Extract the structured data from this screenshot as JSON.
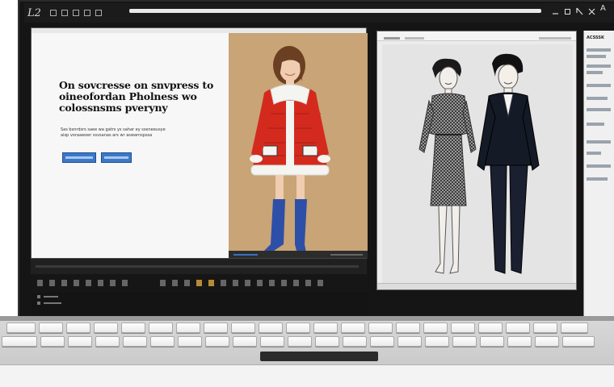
{
  "window": {
    "title": "L2"
  },
  "left_app": {
    "headline": "On sovcresse on snvpress to oineofordan Pholness wo colossnsms pveryny",
    "body_lines": [
      "Sas bsnrdsrs saee wa gatrs ys sahar ey sseneeusye",
      "aisp voraawoer ssvsanas ars wr  aswarnspssa"
    ],
    "buttons": [
      "",
      ""
    ],
    "accent_color": "#3c78c8"
  },
  "right_app": {
    "title": "",
    "side_panel_header": "ACSSSK"
  },
  "colors": {
    "bezel": "#151515",
    "keyboard": "#d0d0d0",
    "photo_bg": "#c8a476",
    "coat_red": "#d42a1e",
    "boots_blue": "#2d4fa8"
  },
  "icons": [
    "minimize-icon",
    "maximize-icon",
    "close-icon",
    "text-icon",
    "toolbar-icons"
  ]
}
